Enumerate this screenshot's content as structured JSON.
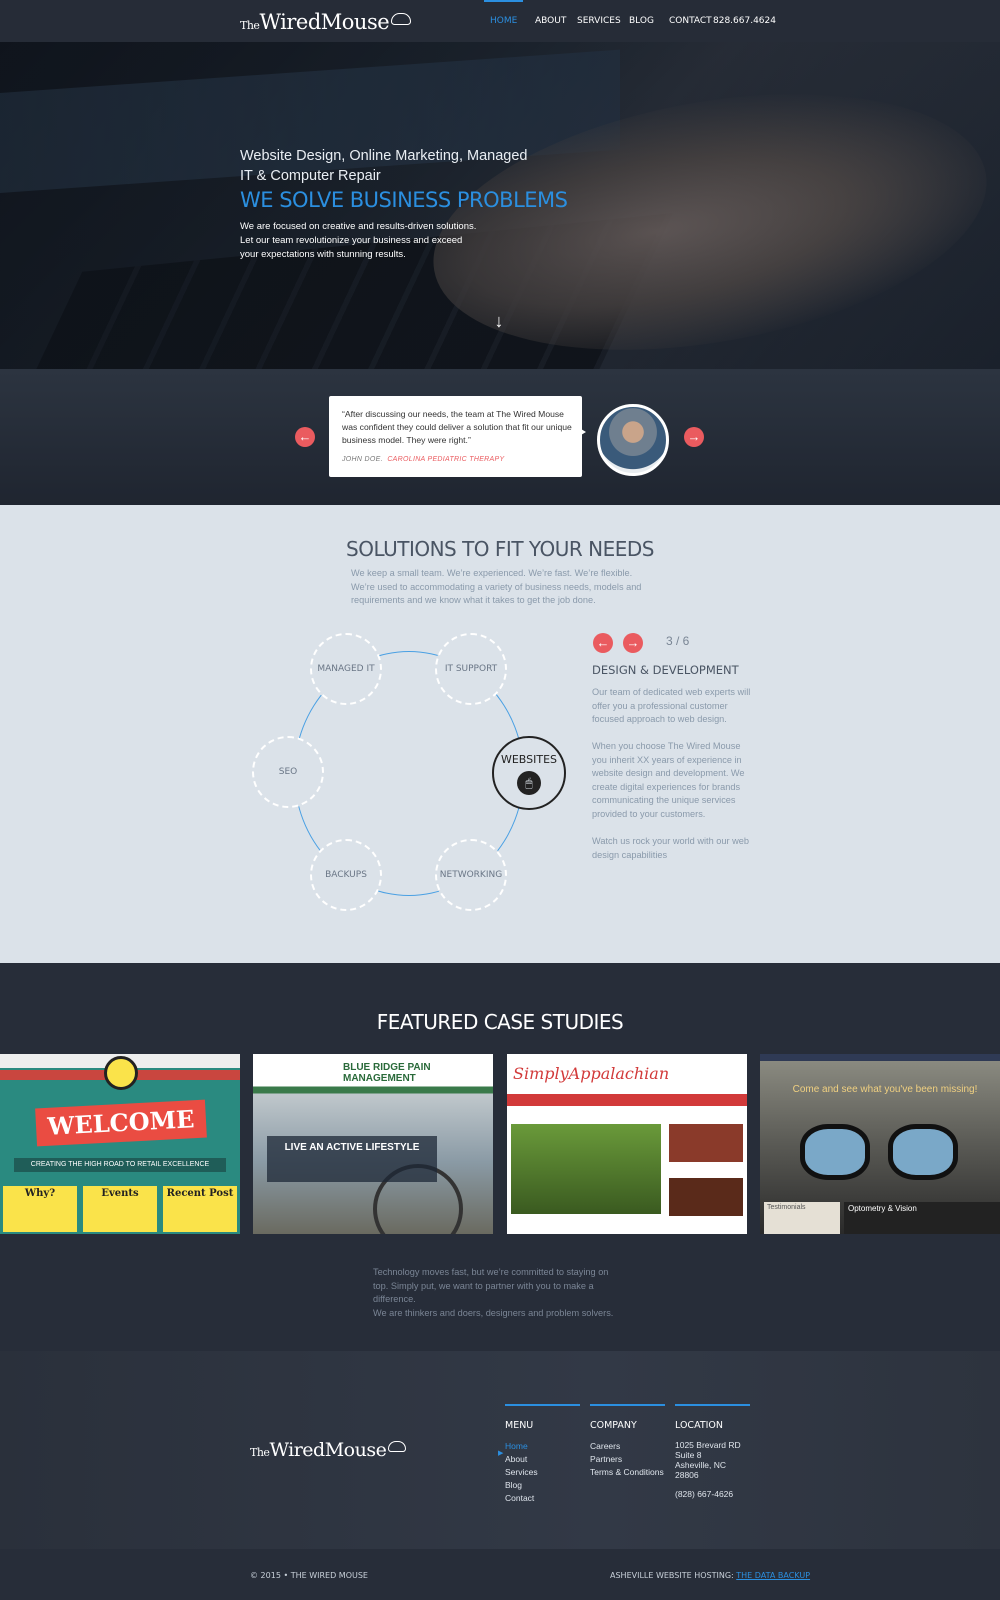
{
  "nav": {
    "logo_the": "The",
    "logo_name": "WiredMouse",
    "items": [
      "HOME",
      "ABOUT",
      "SERVICES",
      "BLOG",
      "CONTACT"
    ],
    "phone": "828.667.4624"
  },
  "hero": {
    "subtitle": "Website Design, Online Marketing, Managed IT & Computer Repair",
    "title": "WE SOLVE BUSINESS PROBLEMS",
    "description": "We are focused on creative and results-driven solutions. Let our team revolutionize your business and exceed your expectations with stunning results.",
    "arrow": "↓"
  },
  "testimonial": {
    "prev": "←",
    "next": "→",
    "quote": "“After discussing our needs, the team at The Wired Mouse was confident they could deliver a solution that fit our unique business model. They were right.”",
    "author": "JOHN DOE.",
    "company": "CAROLINA PEDIATRIC THERAPY"
  },
  "solutions": {
    "title": "SOLUTIONS TO FIT YOUR NEEDS",
    "description": "We keep a small team. We’re experienced. We’re fast. We’re flexible. We’re used to accommodating a variety of business needs, models and requirements and we know what it takes to get the job done.",
    "nodes": [
      "MANAGED IT",
      "IT SUPPORT",
      "WEBSITES",
      "NETWORKING",
      "BACKUPS",
      "SEO"
    ],
    "prev": "←",
    "next": "→",
    "counter": "3 / 6",
    "detail_title": "DESIGN & DEVELOPMENT",
    "detail_p1": "Our team of dedicated web experts will offer you a professional customer focused approach to web design.",
    "detail_p2": "When you choose The Wired Mouse you inherit XX years of experience in website design and development. We create digital experiences for brands communicating the unique services provided to your customers.",
    "detail_p3": "Watch us rock your world with our web design capabilities"
  },
  "cases": {
    "title": "FEATURED CASE STUDIES",
    "t1": {
      "welcome": "WELCOME",
      "tagline": "CREATING THE HIGH ROAD TO RETAIL EXCELLENCE",
      "boxes": [
        "Why?",
        "Events",
        "Recent Post"
      ]
    },
    "t2": {
      "brand": "BLUE RIDGE PAIN MANAGEMENT",
      "headline": "LIVE AN ACTIVE LIFESTYLE"
    },
    "t3": {
      "brand_a": "Simply",
      "brand_b": "Appalachian"
    },
    "t4": {
      "headline": "Come and see what you've been missing!",
      "panel": "Optometry & Vision",
      "testimonials": "Testimonials"
    },
    "text_p1": "Technology moves fast, but we’re committed to staying on top. Simply put, we want to partner with you to make a difference.",
    "text_p2": "We are thinkers and doers, designers and problem solvers."
  },
  "footer": {
    "logo_the": "The",
    "logo_name": "WiredMouse",
    "menu_title": "MENU",
    "menu": [
      "Home",
      "About",
      "Services",
      "Blog",
      "Contact"
    ],
    "company_title": "COMPANY",
    "company": [
      "Careers",
      "Partners",
      "Terms & Conditions"
    ],
    "location_title": "LOCATION",
    "address": [
      "1025 Brevard RD",
      "Suite 8",
      "Asheville, NC",
      "28806"
    ],
    "phone": "(828) 667-4626",
    "copyright": "© 2015 • THE WIRED MOUSE",
    "hosting_label": "ASHEVILLE WEBSITE HOSTING:",
    "hosting_link": "THE DATA BACKUP"
  }
}
